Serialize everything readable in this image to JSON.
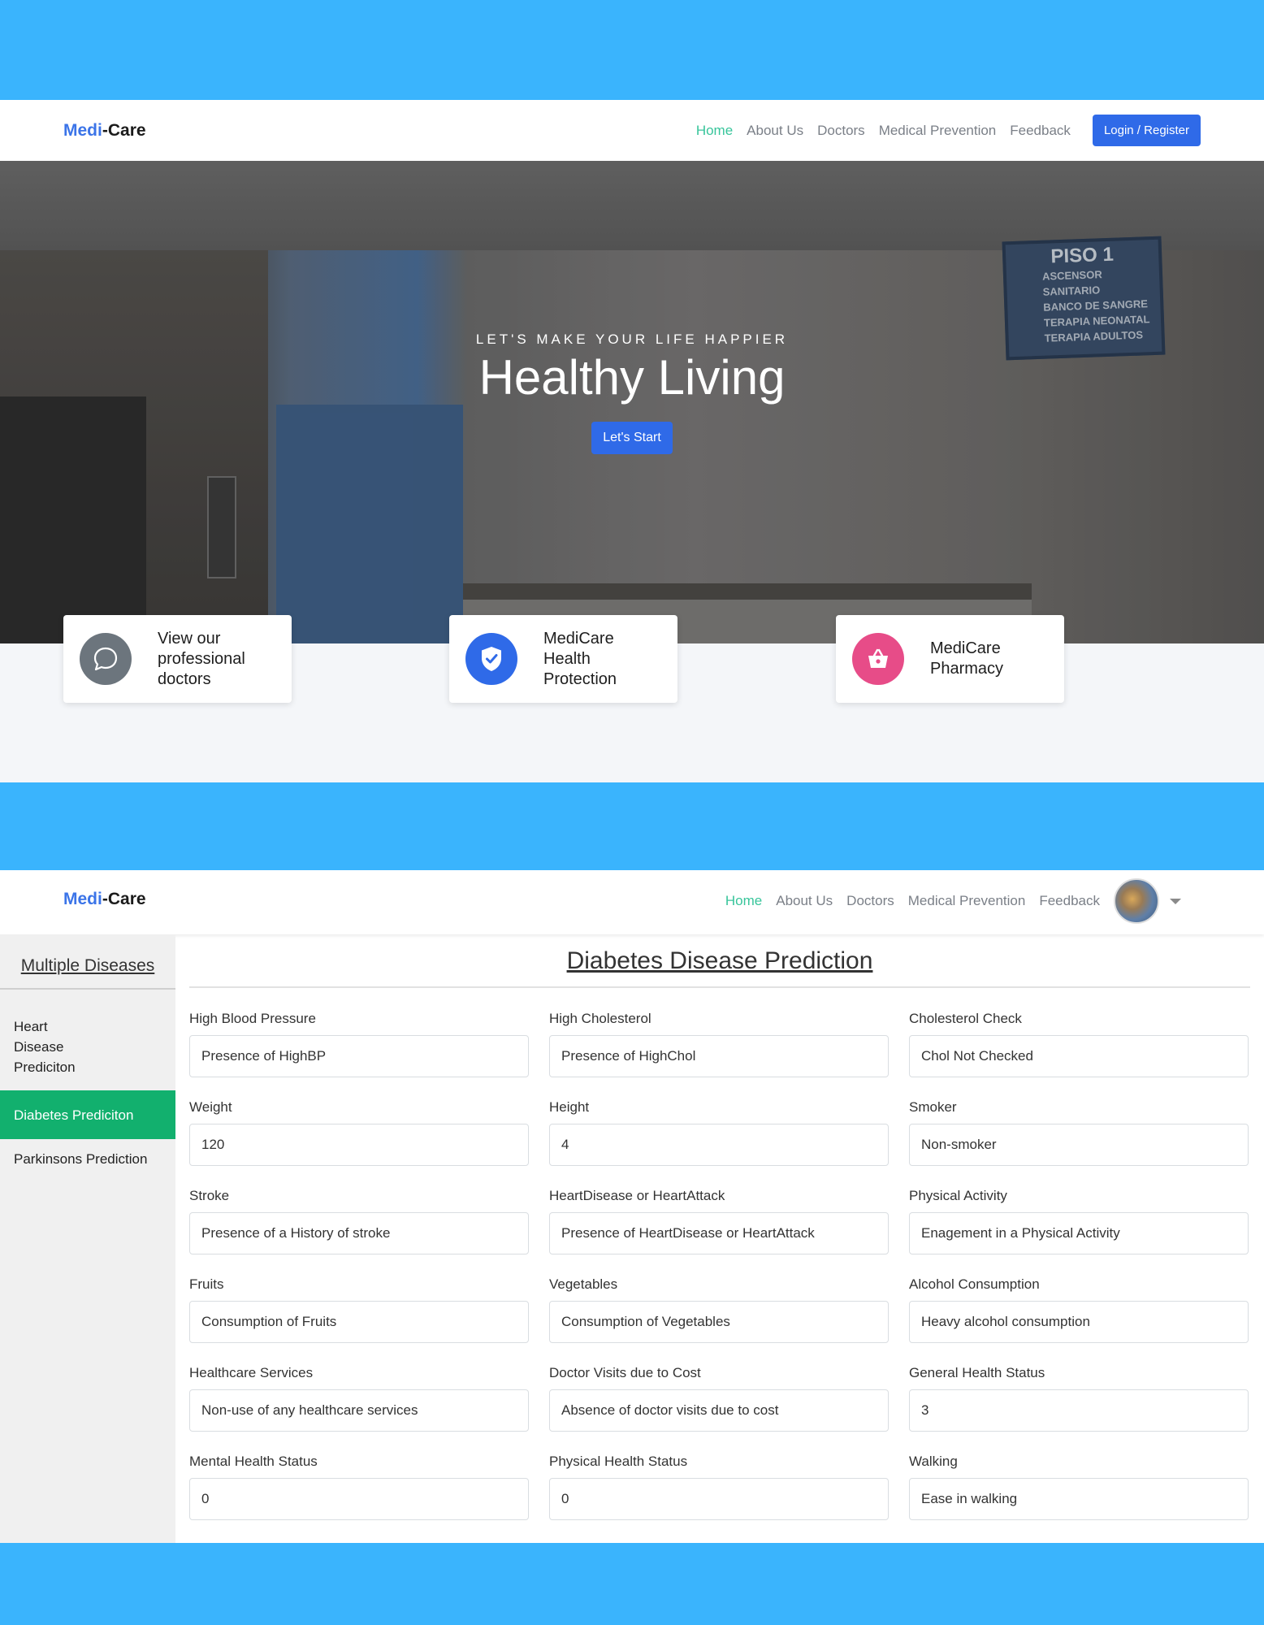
{
  "landing": {
    "brand": {
      "part1": "Medi",
      "sep": "-",
      "part2": "Care"
    },
    "nav": [
      "Home",
      "About Us",
      "Doctors",
      "Medical Prevention",
      "Feedback"
    ],
    "login_label": "Login / Register",
    "hero": {
      "subtitle": "LET'S MAKE YOUR LIFE HAPPIER",
      "title": "Healthy Living",
      "cta": "Let's Start",
      "sign": {
        "title": "PISO 1",
        "lines": [
          "ASCENSOR",
          "SANITARIO",
          "BANCO DE SANGRE",
          "TERAPIA NEONATAL",
          "TERAPIA ADULTOS"
        ]
      }
    },
    "features": [
      {
        "text": "View our professional doctors",
        "icon": "chat-icon",
        "color": "#6c757d"
      },
      {
        "text": "MediCare Health Protection",
        "icon": "shield-check-icon",
        "color": "#2f6ae8"
      },
      {
        "text": "MediCare Pharmacy",
        "icon": "basket-icon",
        "color": "#e74c88"
      }
    ]
  },
  "app": {
    "brand": {
      "part1": "Medi",
      "sep": "-",
      "part2": "Care"
    },
    "nav": [
      "Home",
      "About Us",
      "Doctors",
      "Medical Prevention",
      "Feedback"
    ],
    "sidebar": {
      "title": "Multiple Diseases",
      "items": [
        "Heart Disease Prediciton",
        "Diabetes Prediciton",
        "Parkinsons Prediction"
      ],
      "active_index": 1
    },
    "page_title": "Diabetes Disease Prediction",
    "fields": [
      {
        "label": "High Blood Pressure",
        "value": "Presence of HighBP"
      },
      {
        "label": "High Cholesterol",
        "value": "Presence of HighChol"
      },
      {
        "label": "Cholesterol Check",
        "value": "Chol Not Checked"
      },
      {
        "label": "Weight",
        "value": "120"
      },
      {
        "label": "Height",
        "value": "4"
      },
      {
        "label": "Smoker",
        "value": "Non-smoker"
      },
      {
        "label": "Stroke",
        "value": "Presence of a History of stroke"
      },
      {
        "label": "HeartDisease or HeartAttack",
        "value": "Presence of HeartDisease or HeartAttack"
      },
      {
        "label": "Physical Activity",
        "value": "Enagement in a Physical Activity"
      },
      {
        "label": "Fruits",
        "value": "Consumption of Fruits"
      },
      {
        "label": "Vegetables",
        "value": "Consumption of Vegetables"
      },
      {
        "label": "Alcohol Consumption",
        "value": "Heavy alcohol consumption"
      },
      {
        "label": "Healthcare Services",
        "value": "Non-use of any healthcare services"
      },
      {
        "label": "Doctor Visits due to Cost",
        "value": "Absence of doctor visits due to cost"
      },
      {
        "label": "General Health Status",
        "value": "3"
      },
      {
        "label": "Mental Health Status",
        "value": "0"
      },
      {
        "label": "Physical Health Status",
        "value": "0"
      },
      {
        "label": "Walking",
        "value": "Ease in walking"
      }
    ]
  }
}
